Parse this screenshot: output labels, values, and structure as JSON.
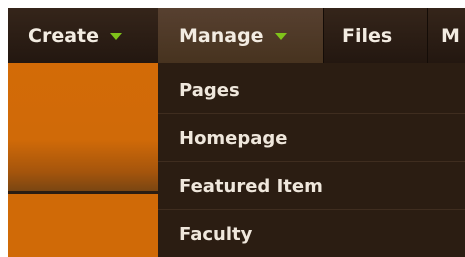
{
  "nav": {
    "items": [
      {
        "label": "Create",
        "has_dropdown": true
      },
      {
        "label": "Manage",
        "has_dropdown": true,
        "active": true
      },
      {
        "label": "Files",
        "has_dropdown": false
      },
      {
        "label": "M",
        "has_dropdown": false
      }
    ]
  },
  "dropdown": {
    "items": [
      {
        "label": "Pages"
      },
      {
        "label": "Homepage"
      },
      {
        "label": "Featured Item"
      },
      {
        "label": "Faculty"
      }
    ]
  },
  "colors": {
    "navbar": "#2b1d12",
    "active_tab": "#4f3a28",
    "accent_orange": "#d06a07",
    "caret_green": "#7fc31a",
    "text": "#f3ece2"
  },
  "icons": {
    "dropdown_caret": "chevron-down-icon"
  }
}
